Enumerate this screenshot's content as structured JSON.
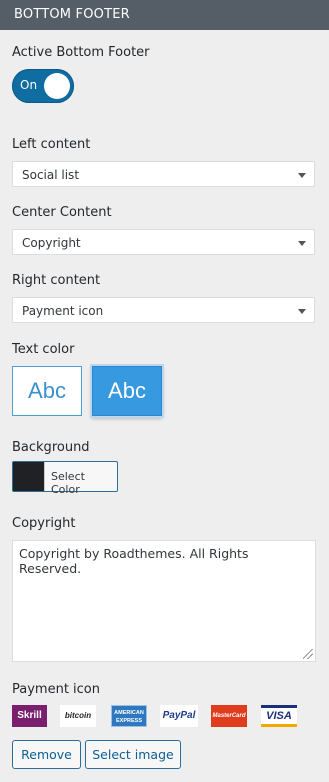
{
  "header": {
    "title": "BOTTOM FOOTER"
  },
  "active_footer": {
    "label": "Active Bottom Footer",
    "toggle_text": "On"
  },
  "left_content": {
    "label": "Left content",
    "value": "Social list"
  },
  "center_content": {
    "label": "Center Content",
    "value": "Copyright"
  },
  "right_content": {
    "label": "Right content",
    "value": "Payment icon"
  },
  "text_color": {
    "label": "Text color",
    "light_sample": "Abc",
    "dark_sample": "Abc"
  },
  "background": {
    "label": "Background",
    "button_label": "Select Color",
    "selected_color": "#1f2124"
  },
  "copyright": {
    "label": "Copyright",
    "value": "Copyright by Roadthemes. All Rights Reserved."
  },
  "payment_icon": {
    "label": "Payment icon",
    "icons": [
      "Skrill",
      "bitcoin",
      "AMERICAN EXPRESS",
      "PayPal",
      "MasterCard",
      "VISA"
    ],
    "remove_label": "Remove",
    "select_label": "Select image"
  },
  "colors": {
    "header_bg": "#555d66",
    "accent": "#0f6da2",
    "swatch_blue": "#3799df"
  }
}
